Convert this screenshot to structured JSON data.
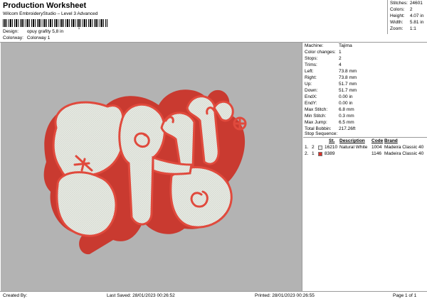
{
  "header": {
    "title": "Production Worksheet",
    "subtitle": "Wilcom EmbroideryStudio – Level 3 Advanced",
    "barcode_mark": ",",
    "design_label": "Design:",
    "design_value": "opuy grafity 5,8 in",
    "colorway_label": "Colorway:",
    "colorway_value": "Colorway 1"
  },
  "stats": {
    "stitches_label": "Stitches:",
    "stitches_value": "24601",
    "colors_label": "Colors:",
    "colors_value": "2",
    "height_label": "Height:",
    "height_value": "4.07 in",
    "width_label": "Width:",
    "width_value": "5.81 in",
    "zoom_label": "Zoom:",
    "zoom_value": "1:1"
  },
  "info": {
    "machine_label": "Machine:",
    "machine_value": "Tajima",
    "color_changes_label": "Color changes:",
    "color_changes_value": "1",
    "stops_label": "Stops:",
    "stops_value": "2",
    "trims_label": "Trims:",
    "trims_value": "4",
    "left_label": "Left:",
    "left_value": "73.8 mm",
    "right_label": "Right:",
    "right_value": "73.8 mm",
    "up_label": "Up:",
    "up_value": "51.7 mm",
    "down_label": "Down:",
    "down_value": "51.7 mm",
    "endx_label": "EndX:",
    "endx_value": "0.00 in",
    "endy_label": "EndY:",
    "endy_value": "0.00 in",
    "max_stitch_label": "Max Stitch:",
    "max_stitch_value": "6.8 mm",
    "min_stitch_label": "Min Stitch:",
    "min_stitch_value": "0.3 mm",
    "max_jump_label": "Max Jump:",
    "max_jump_value": "6.5 mm",
    "total_bobbin_label": "Total Bobbin:",
    "total_bobbin_value": "217.26ft"
  },
  "sequence": {
    "title": "Stop Sequence:",
    "headers": {
      "st": "St.",
      "description": "Description",
      "code": "Code",
      "brand": "Brand"
    },
    "rows": [
      {
        "num": "1.",
        "stop": "2",
        "color": "#e8e8e8",
        "st": "16210",
        "description": "Natural White",
        "code": "1004",
        "brand": "Madeira Classic 40"
      },
      {
        "num": "2.",
        "stop": "1",
        "color": "#d9332a",
        "st": "8389",
        "description": "",
        "code": "1146",
        "brand": "Madeira Classic 40"
      }
    ]
  },
  "footer": {
    "created_by": "Created By:",
    "last_saved": "Last Saved: 28/01/2023 00:26:52",
    "printed": "Printed: 28/01/2023 00:26:55",
    "page": "Page 1 of 1"
  },
  "colors": {
    "canvas_bg": "#b3b3b3",
    "thread_red": "#d9332a",
    "thread_white": "#e8ebe4"
  }
}
